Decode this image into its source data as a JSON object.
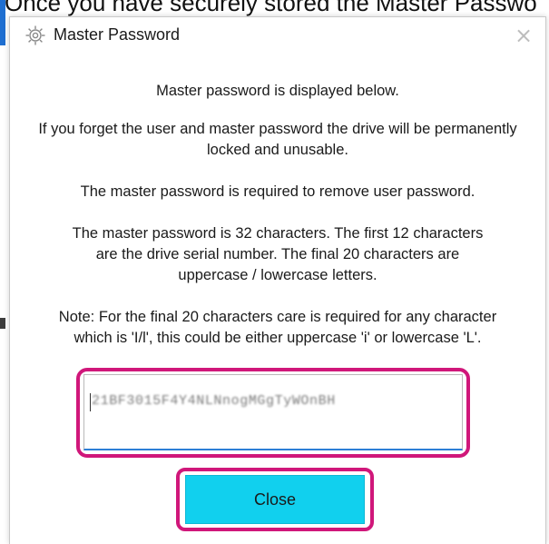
{
  "background": {
    "caption": "Once you have securely stored the Master Passwo"
  },
  "dialog": {
    "title": "Master Password",
    "title_icon": "gear-icon",
    "close_glyph": "×",
    "messages": {
      "line1": "Master password is displayed below.",
      "line2": "If you forget the user and master password the drive will be permanently locked and unusable.",
      "line3": "The master password is required to remove user password.",
      "line4": "The master password is 32 characters. The first 12 characters are the drive serial number. The final 20 characters are uppercase / lowercase letters.",
      "line5": "Note: For the final 20 characters care is required for any character which is 'I/l', this could be either uppercase 'i' or lowercase 'L'."
    },
    "password_value": "21BF3015F4Y4NLNnogMGgTyWOnBH",
    "close_button_label": "Close"
  },
  "colors": {
    "highlight": "#d0177a",
    "button_bg": "#11d0ee",
    "field_focus": "#2d7fd6"
  }
}
